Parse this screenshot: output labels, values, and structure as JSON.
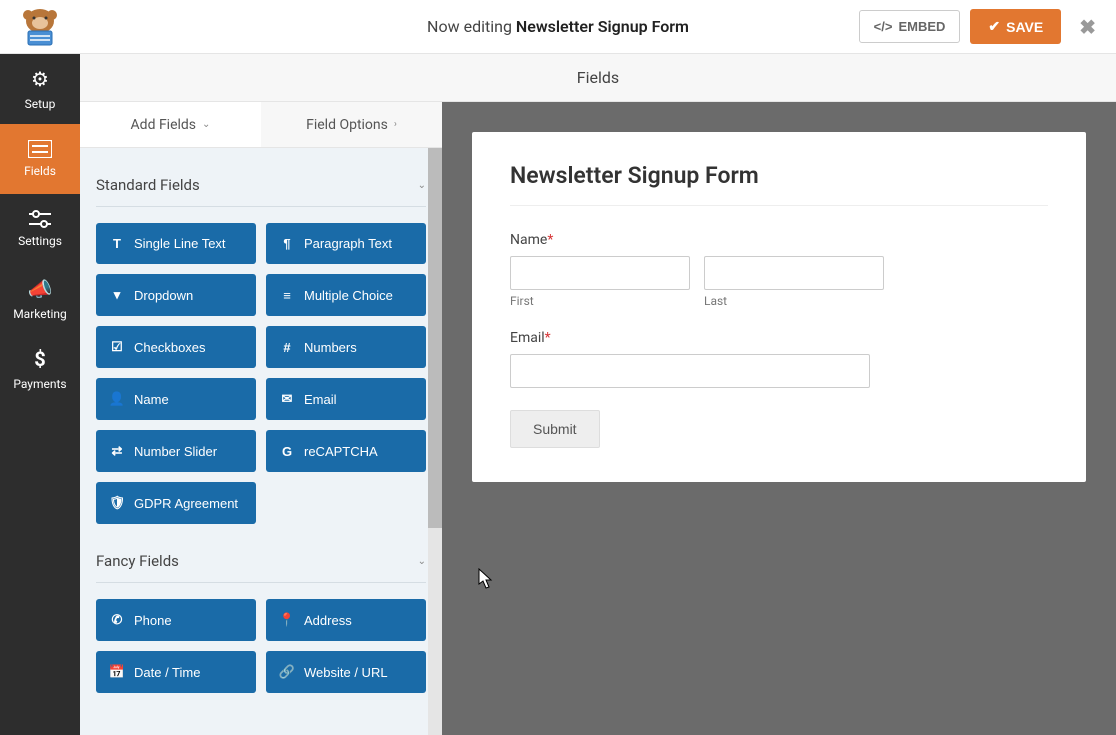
{
  "header": {
    "editing_prefix": "Now editing",
    "form_name": "Newsletter Signup Form",
    "embed_label": "EMBED",
    "save_label": "SAVE"
  },
  "subheader": {
    "title": "Fields"
  },
  "nav": {
    "items": [
      {
        "label": "Setup",
        "icon": "gear"
      },
      {
        "label": "Fields",
        "icon": "list"
      },
      {
        "label": "Settings",
        "icon": "sliders"
      },
      {
        "label": "Marketing",
        "icon": "bullhorn"
      },
      {
        "label": "Payments",
        "icon": "dollar"
      }
    ],
    "active_index": 1
  },
  "panel": {
    "tabs": {
      "add": "Add Fields",
      "options": "Field Options"
    },
    "sections": [
      {
        "title": "Standard Fields",
        "fields": [
          {
            "label": "Single Line Text",
            "icon": "T"
          },
          {
            "label": "Paragraph Text",
            "icon": "¶"
          },
          {
            "label": "Dropdown",
            "icon": "▾"
          },
          {
            "label": "Multiple Choice",
            "icon": "≡"
          },
          {
            "label": "Checkboxes",
            "icon": "☑"
          },
          {
            "label": "Numbers",
            "icon": "#"
          },
          {
            "label": "Name",
            "icon": "👤"
          },
          {
            "label": "Email",
            "icon": "✉"
          },
          {
            "label": "Number Slider",
            "icon": "⇄"
          },
          {
            "label": "reCAPTCHA",
            "icon": "G"
          },
          {
            "label": "GDPR Agreement",
            "icon": "🛡"
          }
        ]
      },
      {
        "title": "Fancy Fields",
        "fields": [
          {
            "label": "Phone",
            "icon": "✆"
          },
          {
            "label": "Address",
            "icon": "📍"
          },
          {
            "label": "Date / Time",
            "icon": "📅"
          },
          {
            "label": "Website / URL",
            "icon": "🔗"
          }
        ]
      }
    ]
  },
  "form_preview": {
    "title": "Newsletter Signup Form",
    "name_field": {
      "label": "Name",
      "required": true,
      "first_sublabel": "First",
      "last_sublabel": "Last"
    },
    "email_field": {
      "label": "Email",
      "required": true
    },
    "submit_label": "Submit"
  },
  "colors": {
    "accent": "#e27730",
    "field_button": "#1a6ba8"
  }
}
